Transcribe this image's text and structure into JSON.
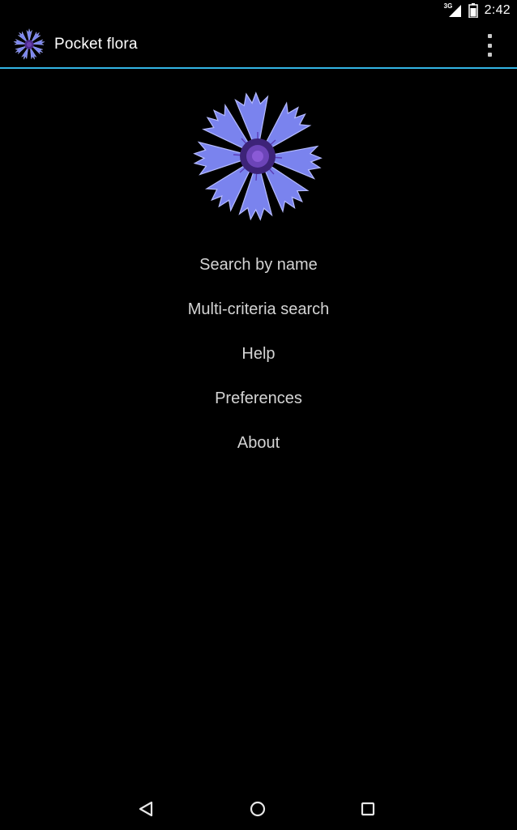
{
  "status_bar": {
    "network_label": "3G",
    "time": "2:42",
    "icons": [
      "signal-icon",
      "battery-icon"
    ]
  },
  "action_bar": {
    "title": "Pocket flora",
    "app_icon": "cornflower-icon",
    "overflow_icon": "overflow-menu-icon",
    "divider_color": "#33b5e5"
  },
  "hero": {
    "image": "cornflower-image"
  },
  "menu": {
    "items": [
      {
        "label": "Search by name"
      },
      {
        "label": "Multi-criteria search"
      },
      {
        "label": "Help"
      },
      {
        "label": "Preferences"
      },
      {
        "label": "About"
      }
    ]
  },
  "nav_bar": {
    "icons": [
      "back-icon",
      "home-icon",
      "recents-icon"
    ]
  },
  "colors": {
    "background": "#000000",
    "accent": "#33b5e5",
    "flower_petal": "#7a83ee",
    "flower_center": "#4b2a8a"
  }
}
